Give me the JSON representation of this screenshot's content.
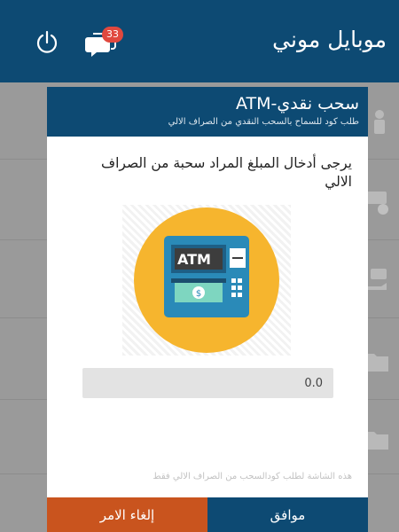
{
  "app": {
    "title": "موبايل موني",
    "notification_count": "33"
  },
  "dialog": {
    "title": "سحب نقدي-ATM",
    "subtitle": "طلب كود للسماح بالسحب النقدي من الصراف الالي",
    "prompt": "يرجى أدخال المبلغ المراد سحبة من الصراف الالي",
    "illustration_label": "ATM",
    "amount_value": "0.0",
    "footnote": "هذه الشاشة لطلب كودالسحب من الصراف الالي فقط",
    "ok_label": "موافق",
    "cancel_label": "إلغاء الامر"
  },
  "colors": {
    "primary": "#0d4a73",
    "cancel": "#c9541e",
    "badge": "#e0483e",
    "illustration_circle": "#f6b52e",
    "atm_body": "#2a8ab8"
  },
  "icons": [
    "power-icon",
    "chat-icon",
    "atm-icon"
  ]
}
